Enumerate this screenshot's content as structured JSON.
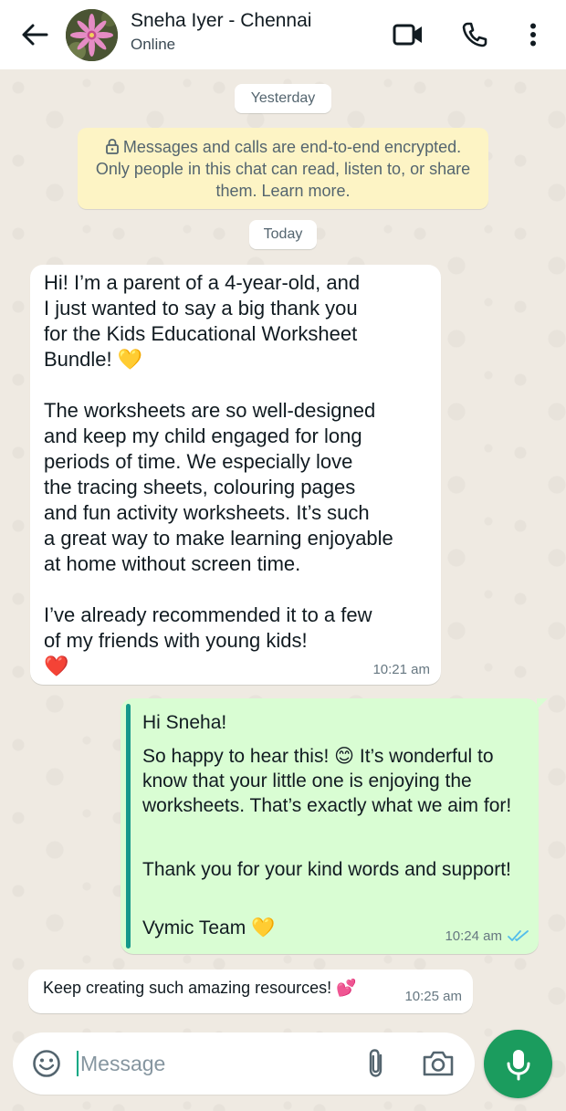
{
  "header": {
    "contact_name": "Sneha Iyer - Chennai",
    "status": "Online",
    "icons": [
      "back-arrow-icon",
      "video-call-icon",
      "phone-icon",
      "more-vertical-icon"
    ]
  },
  "date_pills": {
    "yesterday": "Yesterday",
    "today": "Today"
  },
  "encryption_notice": "Messages and calls are end-to-end encrypted. Only people in this chat can read, listen to, or share them. Learn more.",
  "messages": [
    {
      "direction": "incoming",
      "text": "Hi! I’m a parent of a 4-year-old, and\nI just wanted to say a big thank you\nfor the Kids Educational Worksheet\nBundle! 💛\n\nThe worksheets are so well-designed\nand keep my child engaged for long\nperiods of time. We especially love\nthe tracing sheets, colouring pages\nand fun activity worksheets. It’s such\na great way to make learning enjoyable\nat home without screen time.\n\nI’ve already recommended it to a few\nof my friends with young kids!\n❤️",
      "time": "10:21 am"
    },
    {
      "direction": "outgoing",
      "greeting": "Hi Sneha!",
      "body": "So happy to hear this! 😊 It’s wonderful to know that your little one is enjoying the worksheets. That’s exactly what we aim for!",
      "thanks": "Thank you for your kind words and support!",
      "signature": "Vymic Team 💛",
      "time": "10:24 am",
      "status": "read"
    },
    {
      "direction": "incoming",
      "text": "Keep creating such amazing resources! 💕",
      "time": "10:25 am"
    }
  ],
  "composer": {
    "placeholder": "Message",
    "icons": [
      "emoji-icon",
      "attach-icon",
      "camera-icon",
      "mic-icon"
    ]
  },
  "colors": {
    "chat_background": "#efeae2",
    "incoming_bubble": "#ffffff",
    "outgoing_bubble": "#d9fdd3",
    "encryption_bg": "#fdf4c5",
    "accent": "#1b9c5e",
    "read_ticks": "#53bdeb"
  }
}
